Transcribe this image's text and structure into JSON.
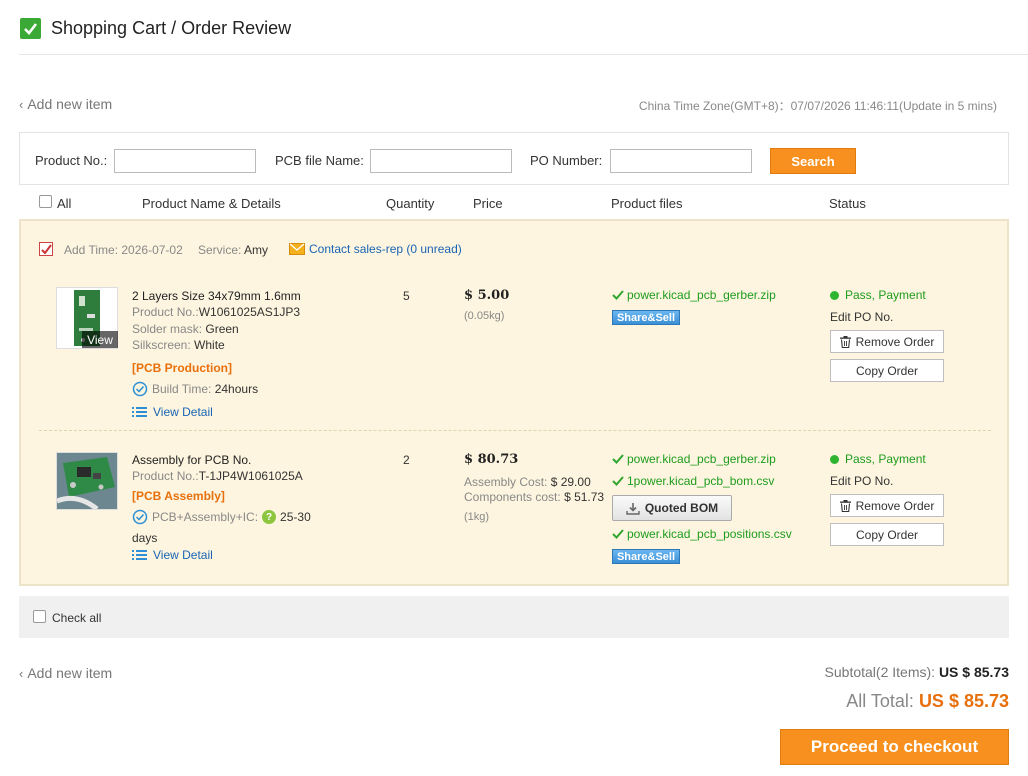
{
  "header": {
    "title": "Shopping Cart / Order Review"
  },
  "nav": {
    "add_new_item": "Add new item"
  },
  "timezone": {
    "text": "China Time Zone(GMT+8)：07/07/2026 11:46:11(Update in 5 mins)"
  },
  "search": {
    "product_no_label": "Product No.:",
    "pcb_file_label": "PCB file Name:",
    "po_number_label": "PO Number:",
    "button": "Search"
  },
  "table_header": {
    "all": "All",
    "product": "Product Name & Details",
    "quantity": "Quantity",
    "price": "Price",
    "files": "Product files",
    "status": "Status"
  },
  "order": {
    "add_time_label": "Add Time:",
    "add_time": "2026-07-02",
    "service_label": "Service:",
    "service": "Amy",
    "contact": "Contact sales-rep (0 unread)",
    "items": [
      {
        "title": "2 Layers Size 34x79mm 1.6mm",
        "product_no_label": "Product No.:",
        "product_no": "W1061025AS1JP3",
        "solder_label": "Solder mask:",
        "solder": "Green",
        "silk_label": "Silkscreen:",
        "silk": "White",
        "category": "[PCB Production]",
        "build_label": "Build Time:",
        "build": "24hours",
        "view_detail": "View Detail",
        "thumb_label": "View",
        "quantity": "5",
        "price": "$ 5.00",
        "weight": "(0.05kg)",
        "files": [
          "power.kicad_pcb_gerber.zip"
        ],
        "share": "Share&Sell",
        "status": "Pass, Payment",
        "edit_po": "Edit PO No.",
        "remove": "Remove Order",
        "copy": "Copy Order"
      },
      {
        "title": "Assembly for PCB No.",
        "product_no_label": "Product No.:",
        "product_no": "T-1JP4W1061025A",
        "category": "[PCB Assembly]",
        "build_label": "PCB+Assembly+IC:",
        "build_a": "25-30",
        "build_b": "days",
        "view_detail": "View Detail",
        "quantity": "2",
        "price": "$ 80.73",
        "assembly_cost_label": "Assembly Cost:",
        "assembly_cost": "$ 29.00",
        "components_cost_label": "Components cost:",
        "components_cost": "$ 51.73",
        "weight": "(1kg)",
        "files": [
          "power.kicad_pcb_gerber.zip",
          "1power.kicad_pcb_bom.csv",
          "power.kicad_pcb_positions.csv"
        ],
        "quoted_bom": "Quoted BOM",
        "share": "Share&Sell",
        "status": "Pass, Payment",
        "edit_po": "Edit PO No.",
        "remove": "Remove Order",
        "copy": "Copy Order"
      }
    ]
  },
  "footer": {
    "check_all": "Check all",
    "subtotal_label": "Subtotal(2 Items):",
    "subtotal": "US $ 85.73",
    "all_total_label": "All Total:",
    "all_total": "US $ 85.73",
    "checkout": "Proceed to checkout"
  },
  "colors": {
    "accent": "#f7901e",
    "success": "#1e9c1e",
    "link": "#1a64b5",
    "panel": "#fdf5df"
  }
}
